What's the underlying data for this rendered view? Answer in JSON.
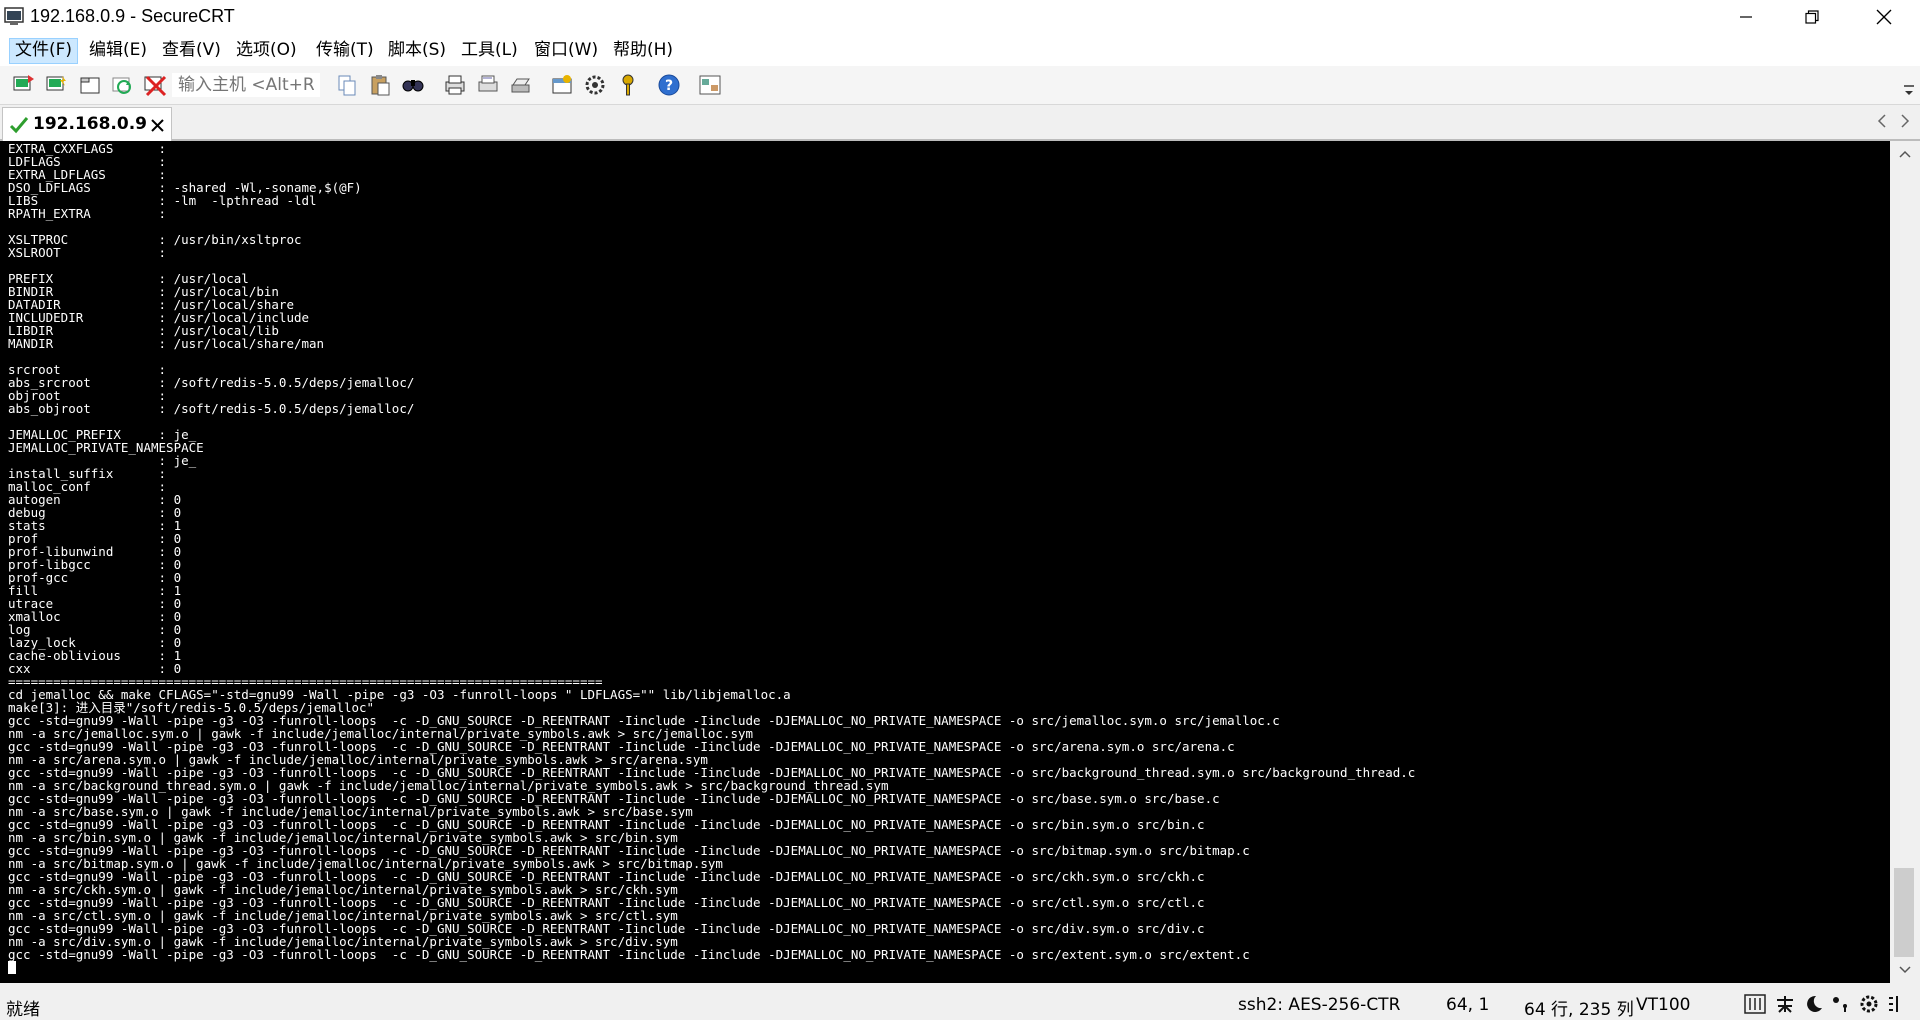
{
  "window": {
    "title": "192.168.0.9 - SecureCRT"
  },
  "menu": [
    "文件(F)",
    "编辑(E)",
    "查看(V)",
    "选项(O)",
    "传输(T)",
    "脚本(S)",
    "工具(L)",
    "窗口(W)",
    "帮助(H)"
  ],
  "toolbar": {
    "host_placeholder": "输入主机 <Alt+R>",
    "icons": [
      "connect-icon",
      "quick-connect-icon",
      "connect-in-tab-icon",
      "reconnect-icon",
      "disconnect-icon",
      "copy-icon",
      "paste-icon",
      "find-icon",
      "print-icon",
      "print-selection-icon",
      "printer-icon",
      "session-options-icon",
      "global-options-icon",
      "keymap-icon",
      "help-icon",
      "sftp-icon"
    ]
  },
  "tab": {
    "label": "192.168.0.9",
    "status_color": "#2e9e2e"
  },
  "terminal": {
    "lines": [
      "EXTRA_CXXFLAGS      :",
      "LDFLAGS             :",
      "EXTRA_LDFLAGS       :",
      "DSO_LDFLAGS         : -shared -Wl,-soname,$(@F)",
      "LIBS                : -lm  -lpthread -ldl",
      "RPATH_EXTRA         :",
      "",
      "XSLTPROC            : /usr/bin/xsltproc",
      "XSLROOT             :",
      "",
      "PREFIX              : /usr/local",
      "BINDIR              : /usr/local/bin",
      "DATADIR             : /usr/local/share",
      "INCLUDEDIR          : /usr/local/include",
      "LIBDIR              : /usr/local/lib",
      "MANDIR              : /usr/local/share/man",
      "",
      "srcroot             :",
      "abs_srcroot         : /soft/redis-5.0.5/deps/jemalloc/",
      "objroot             :",
      "abs_objroot         : /soft/redis-5.0.5/deps/jemalloc/",
      "",
      "JEMALLOC_PREFIX     : je_",
      "JEMALLOC_PRIVATE_NAMESPACE",
      "                    : je_",
      "install_suffix      :",
      "malloc_conf         :",
      "autogen             : 0",
      "debug               : 0",
      "stats               : 1",
      "prof                : 0",
      "prof-libunwind      : 0",
      "prof-libgcc         : 0",
      "prof-gcc            : 0",
      "fill                : 1",
      "utrace              : 0",
      "xmalloc             : 0",
      "log                 : 0",
      "lazy_lock           : 0",
      "cache-oblivious     : 1",
      "cxx                 : 0",
      "===============================================================================",
      "cd jemalloc && make CFLAGS=\"-std=gnu99 -Wall -pipe -g3 -O3 -funroll-loops \" LDFLAGS=\"\" lib/libjemalloc.a",
      "make[3]: 进入目录\"/soft/redis-5.0.5/deps/jemalloc\"",
      "gcc -std=gnu99 -Wall -pipe -g3 -O3 -funroll-loops  -c -D_GNU_SOURCE -D_REENTRANT -Iinclude -Iinclude -DJEMALLOC_NO_PRIVATE_NAMESPACE -o src/jemalloc.sym.o src/jemalloc.c",
      "nm -a src/jemalloc.sym.o | gawk -f include/jemalloc/internal/private_symbols.awk > src/jemalloc.sym",
      "gcc -std=gnu99 -Wall -pipe -g3 -O3 -funroll-loops  -c -D_GNU_SOURCE -D_REENTRANT -Iinclude -Iinclude -DJEMALLOC_NO_PRIVATE_NAMESPACE -o src/arena.sym.o src/arena.c",
      "nm -a src/arena.sym.o | gawk -f include/jemalloc/internal/private_symbols.awk > src/arena.sym",
      "gcc -std=gnu99 -Wall -pipe -g3 -O3 -funroll-loops  -c -D_GNU_SOURCE -D_REENTRANT -Iinclude -Iinclude -DJEMALLOC_NO_PRIVATE_NAMESPACE -o src/background_thread.sym.o src/background_thread.c",
      "nm -a src/background_thread.sym.o | gawk -f include/jemalloc/internal/private_symbols.awk > src/background_thread.sym",
      "gcc -std=gnu99 -Wall -pipe -g3 -O3 -funroll-loops  -c -D_GNU_SOURCE -D_REENTRANT -Iinclude -Iinclude -DJEMALLOC_NO_PRIVATE_NAMESPACE -o src/base.sym.o src/base.c",
      "nm -a src/base.sym.o | gawk -f include/jemalloc/internal/private_symbols.awk > src/base.sym",
      "gcc -std=gnu99 -Wall -pipe -g3 -O3 -funroll-loops  -c -D_GNU_SOURCE -D_REENTRANT -Iinclude -Iinclude -DJEMALLOC_NO_PRIVATE_NAMESPACE -o src/bin.sym.o src/bin.c",
      "nm -a src/bin.sym.o | gawk -f include/jemalloc/internal/private_symbols.awk > src/bin.sym",
      "gcc -std=gnu99 -Wall -pipe -g3 -O3 -funroll-loops  -c -D_GNU_SOURCE -D_REENTRANT -Iinclude -Iinclude -DJEMALLOC_NO_PRIVATE_NAMESPACE -o src/bitmap.sym.o src/bitmap.c",
      "nm -a src/bitmap.sym.o | gawk -f include/jemalloc/internal/private_symbols.awk > src/bitmap.sym",
      "gcc -std=gnu99 -Wall -pipe -g3 -O3 -funroll-loops  -c -D_GNU_SOURCE -D_REENTRANT -Iinclude -Iinclude -DJEMALLOC_NO_PRIVATE_NAMESPACE -o src/ckh.sym.o src/ckh.c",
      "nm -a src/ckh.sym.o | gawk -f include/jemalloc/internal/private_symbols.awk > src/ckh.sym",
      "gcc -std=gnu99 -Wall -pipe -g3 -O3 -funroll-loops  -c -D_GNU_SOURCE -D_REENTRANT -Iinclude -Iinclude -DJEMALLOC_NO_PRIVATE_NAMESPACE -o src/ctl.sym.o src/ctl.c",
      "nm -a src/ctl.sym.o | gawk -f include/jemalloc/internal/private_symbols.awk > src/ctl.sym",
      "gcc -std=gnu99 -Wall -pipe -g3 -O3 -funroll-loops  -c -D_GNU_SOURCE -D_REENTRANT -Iinclude -Iinclude -DJEMALLOC_NO_PRIVATE_NAMESPACE -o src/div.sym.o src/div.c",
      "nm -a src/div.sym.o | gawk -f include/jemalloc/internal/private_symbols.awk > src/div.sym",
      "gcc -std=gnu99 -Wall -pipe -g3 -O3 -funroll-loops  -c -D_GNU_SOURCE -D_REENTRANT -Iinclude -Iinclude -DJEMALLOC_NO_PRIVATE_NAMESPACE -o src/extent.sym.o src/extent.c"
    ]
  },
  "status": {
    "ready": "就绪",
    "protocol": "ssh2: AES-256-CTR",
    "position": "64,  1",
    "size": "64 行, 235 列",
    "terminal_type": "VT100",
    "tray_icons": [
      "input-method-icon",
      "chinese-english-icon",
      "moon-icon",
      "punctuation-icon",
      "settings-icon",
      "keyboard-icon"
    ]
  }
}
